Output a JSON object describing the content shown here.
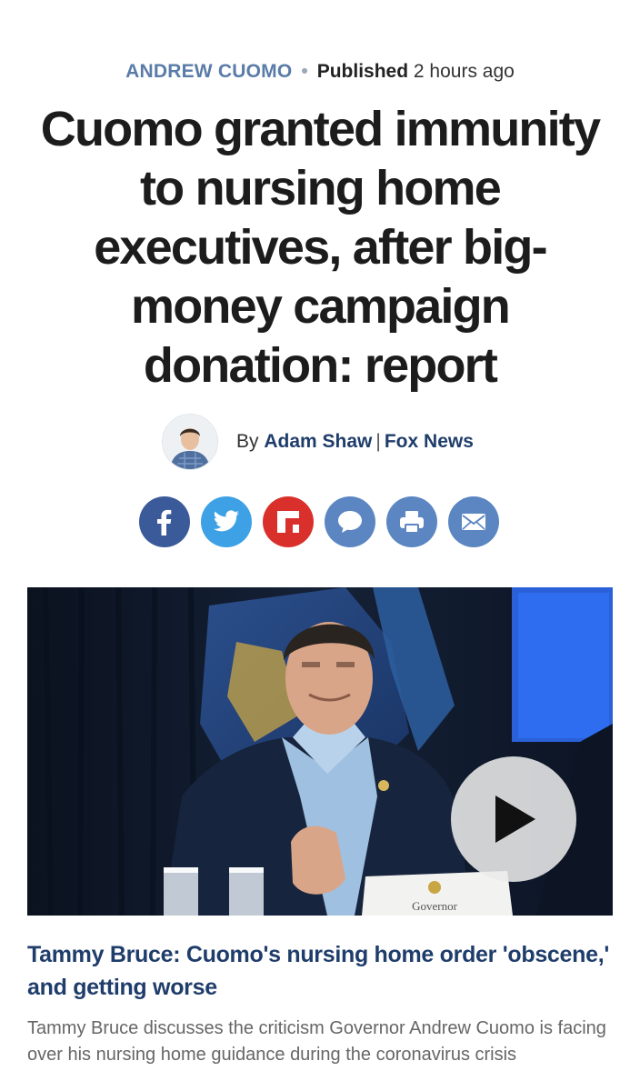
{
  "meta": {
    "category": "ANDREW CUOMO",
    "published_label": "Published",
    "published_time": "2 hours ago"
  },
  "headline": "Cuomo granted immunity to nursing home executives, after big-money campaign donation: report",
  "byline": {
    "prefix": "By",
    "author": "Adam Shaw",
    "separator": "|",
    "outlet": "Fox News"
  },
  "share": [
    {
      "name": "facebook",
      "color": "#3b5a9a"
    },
    {
      "name": "twitter",
      "color": "#3ea1e6"
    },
    {
      "name": "flipboard",
      "color": "#d9302b"
    },
    {
      "name": "comments",
      "color": "#5b86c2"
    },
    {
      "name": "print",
      "color": "#5b86c2"
    },
    {
      "name": "email",
      "color": "#5b86c2"
    }
  ],
  "video": {
    "placard_text": "Governor",
    "play_icon": "play-icon"
  },
  "caption": {
    "title": "Tammy Bruce: Cuomo's nursing home order 'obscene,' and getting worse",
    "description": "Tammy Bruce discusses the criticism Governor Andrew Cuomo is facing over his nursing home guidance during the coronavirus crisis"
  }
}
